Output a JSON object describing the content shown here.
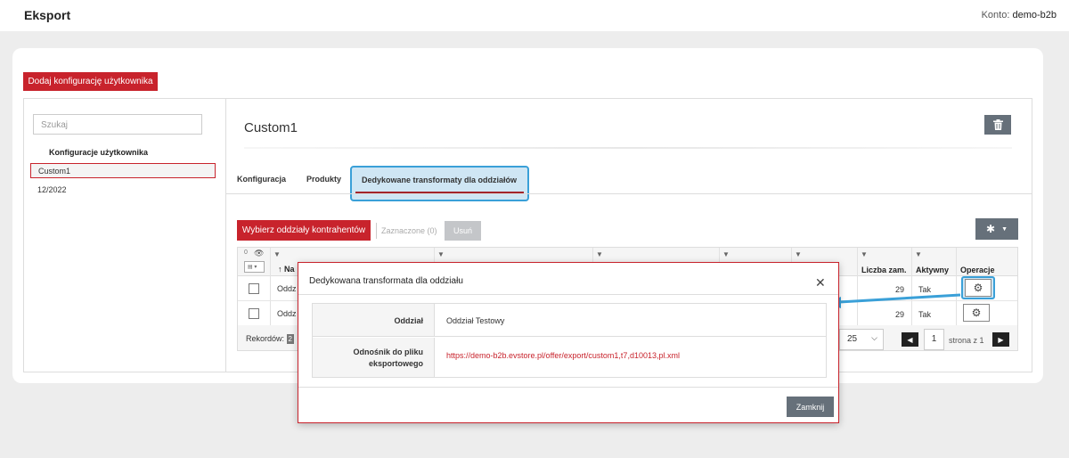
{
  "header": {
    "title": "Eksport",
    "account_label": "Konto:",
    "account_name": "demo-b2b"
  },
  "toolbar": {
    "add_config_label": "Dodaj konfigurację użytkownika"
  },
  "sidebar": {
    "search_placeholder": "Szukaj",
    "section_title": "Konfiguracje użytkownika",
    "items": [
      {
        "label": "Custom1",
        "selected": true
      },
      {
        "label": "12/2022",
        "selected": false
      }
    ]
  },
  "main": {
    "config_title": "Custom1",
    "tabs": [
      {
        "label": "Konfiguracja"
      },
      {
        "label": "Produkty"
      },
      {
        "label": "Dedykowane transformaty dla oddziałów",
        "active": true
      }
    ],
    "actions": {
      "choose_branches_label": "Wybierz oddziały kontrahentów",
      "marked_label": "Zaznaczone (0)",
      "remove_label": "Usuń"
    },
    "grid": {
      "selected_count": "0",
      "name_header_fragment": "Na",
      "columns": [
        {
          "label": "Liczba zam."
        },
        {
          "label": "Aktywny"
        },
        {
          "label": "Operacje"
        }
      ],
      "rows": [
        {
          "name_fragment": "Oddz",
          "orders": "29",
          "active": "Tak"
        },
        {
          "name_fragment": "Oddz",
          "orders": "29",
          "active": "Tak"
        }
      ],
      "footer": {
        "records_label": "Rekordów:",
        "records_count_fragment": "2",
        "page_size": "25",
        "current_page": "1",
        "page_of_label": "strona z 1"
      }
    }
  },
  "modal": {
    "title": "Dedykowana transformata dla oddziału",
    "fields": [
      {
        "label": "Oddział",
        "value": "Oddział Testowy"
      },
      {
        "label": "Odnośnik do pliku eksportowego",
        "value": "https://demo-b2b.evstore.pl/offer/export/custom1,t7,d10013,pl.xml"
      }
    ],
    "close_label": "Zamknij"
  },
  "colors": {
    "brand_red": "#c8232c",
    "highlight_blue": "#3aa0d8",
    "highlight_fill": "#cfe6f4",
    "button_gray": "#66707a"
  }
}
